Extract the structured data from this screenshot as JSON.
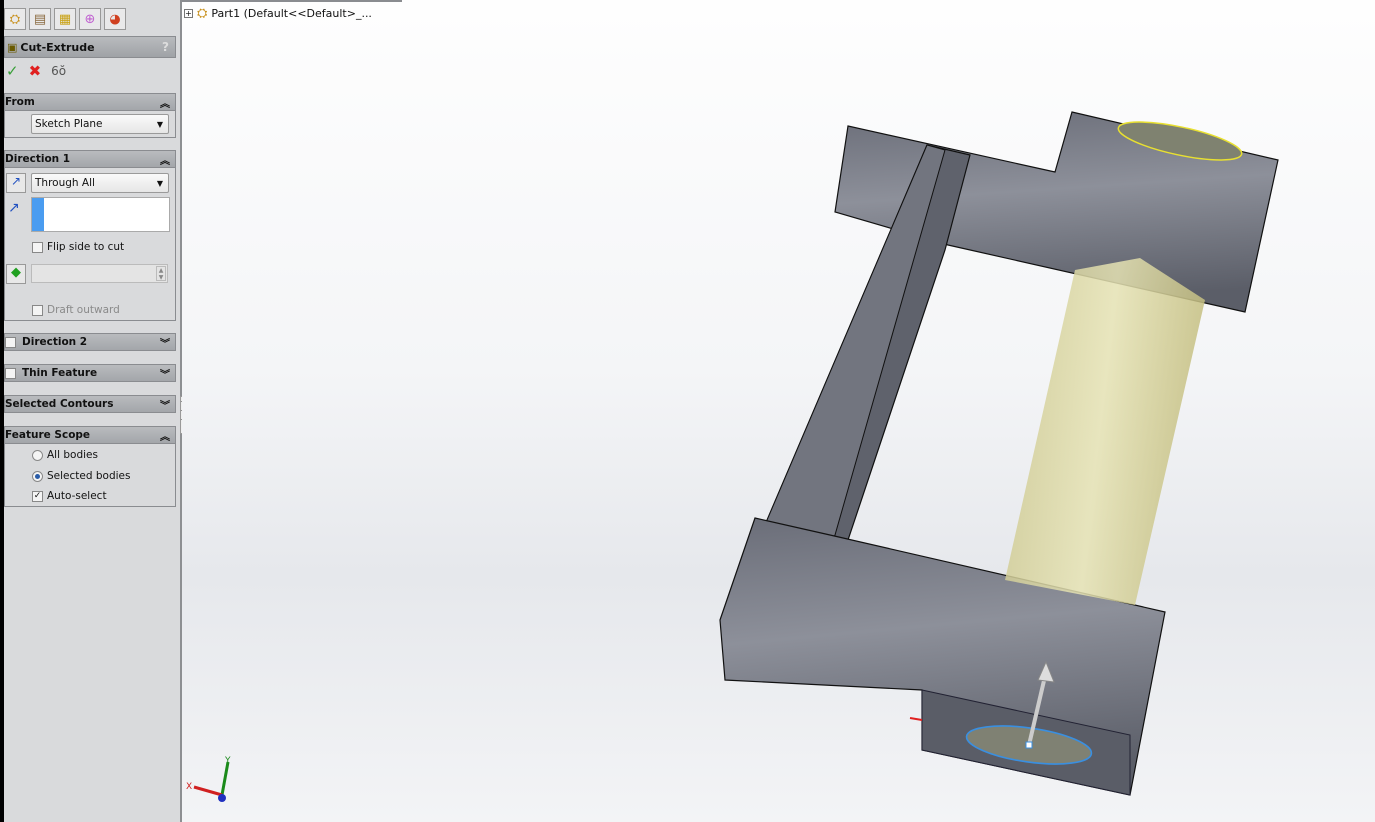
{
  "panel": {
    "tabs": [
      "feature-manager-icon",
      "property-manager-icon",
      "configuration-manager-icon",
      "dimxpert-icon",
      "display-manager-icon"
    ],
    "title": "Cut-Extrude",
    "help": "?",
    "from": {
      "label": "From",
      "value": "Sketch Plane"
    },
    "direction1": {
      "label": "Direction 1",
      "end_condition": "Through All",
      "flip_label": "Flip side to cut",
      "draft_outward_label": "Draft outward"
    },
    "direction2": {
      "label": "Direction 2"
    },
    "thin_feature": {
      "label": "Thin Feature"
    },
    "selected_contours": {
      "label": "Selected Contours"
    },
    "feature_scope": {
      "label": "Feature Scope",
      "all_bodies": "All bodies",
      "selected_bodies": "Selected bodies",
      "auto_select": "Auto-select",
      "selected_option": "Selected bodies",
      "auto_select_checked": true
    }
  },
  "tree": {
    "root": "Part1  (Default<<Default>_..."
  },
  "triad": {
    "x": "X",
    "y": "Y"
  },
  "colors": {
    "model": "#6b6e78",
    "preview": "#d9d59a",
    "selection": "#3a8fe0",
    "highlight": "#e8e030"
  }
}
